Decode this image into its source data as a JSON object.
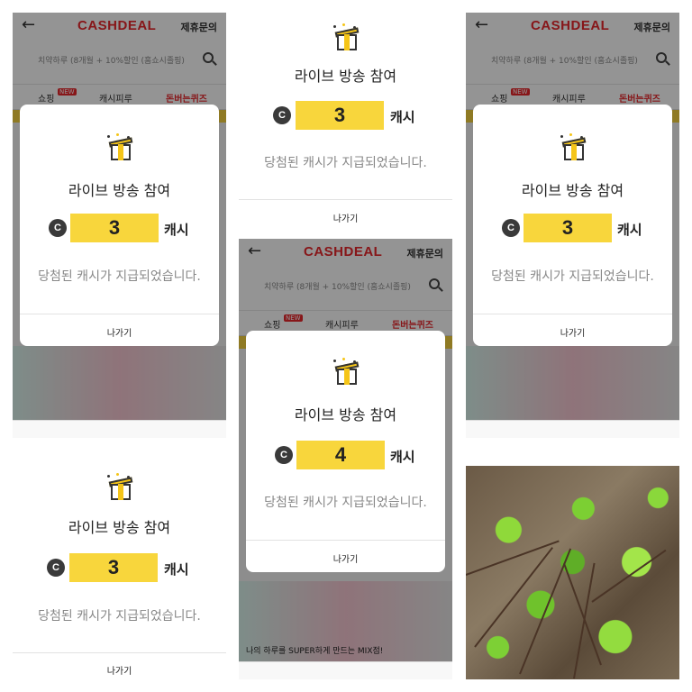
{
  "app": {
    "logo": "CASHDEAL",
    "contact": "제휴문의",
    "search_text": "치약하루 (8개월 + 10%할인 (홈쇼시졸핑)",
    "tabs": [
      {
        "label": "쇼핑",
        "badge": "NEW"
      },
      {
        "label": "캐시피루"
      },
      {
        "label": "돈버는퀴즈"
      }
    ],
    "banner_caption": "나의 하루를 SUPER하게 만드는 MIX점!"
  },
  "modal": {
    "title": "라이브 방송 참여",
    "coin_symbol": "C",
    "unit": "캐시",
    "message": "당첨된 캐시가 지급되었습니다.",
    "exit_label": "나가기"
  },
  "screens": [
    {
      "amount": "3"
    },
    {
      "amount": "3"
    },
    {
      "amount": "3"
    },
    {
      "amount": "4"
    },
    {
      "amount": "3"
    }
  ],
  "colors": {
    "brand_red": "#e8272b",
    "amount_yellow": "#f8d63c",
    "coin_dark": "#3a3a3a",
    "leaf_green": "#8fd93a"
  },
  "icons": [
    "back-arrow-icon",
    "search-icon",
    "gift-icon",
    "coin-icon"
  ]
}
